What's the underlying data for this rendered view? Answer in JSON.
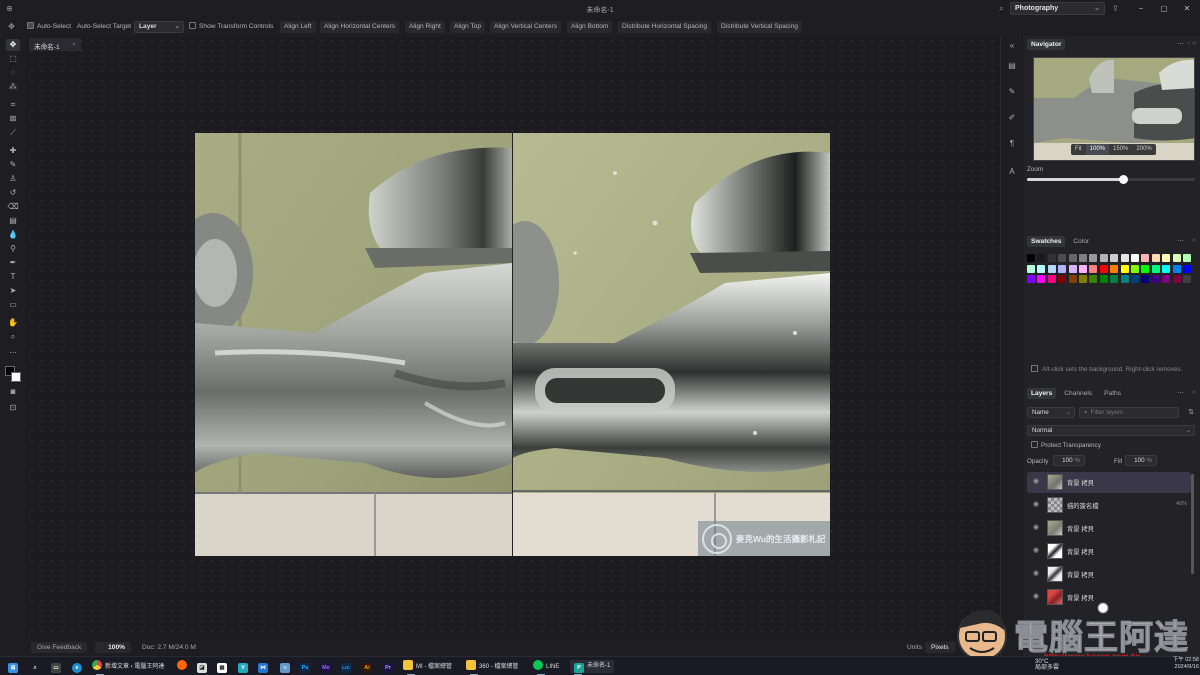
{
  "window": {
    "title": "未命名-1",
    "workspace": "Photography",
    "minimize": "−",
    "maximize": "▢",
    "close": "✕"
  },
  "options_bar": {
    "auto_select": "Auto-Select",
    "auto_select_target": "Auto-Select Target",
    "target_value": "Layer",
    "show_transform": "Show Transform Controls",
    "align_buttons": [
      "Align Left",
      "Align Horizontal Centers",
      "Align Right",
      "Align Top",
      "Align Vertical Centers",
      "Align Bottom",
      "Distribute Horizontal Spacing",
      "Distribute Vertical Spacing"
    ]
  },
  "document": {
    "tab_name": "未命名-1",
    "watermark_text": "麥克Wu的生活攝影札記"
  },
  "statusbar": {
    "feedback": "Give Feedback",
    "zoom": "100%",
    "doc_info": "Doc: 2.7 M/24.0 M",
    "units_label": "Units",
    "units_value": "Pixels"
  },
  "navigator": {
    "tab": "Navigator",
    "zoom_buttons": [
      "Fit",
      "100%",
      "150%",
      "200%"
    ],
    "active_zoom": "100%",
    "zoom_label": "Zoom",
    "zoom_level": 0.57
  },
  "swatches": {
    "tabs": [
      "Swatches",
      "Color"
    ],
    "hint": "Alt-click sets the background. Right-click removes.",
    "colors": [
      "#000000",
      "#1a1a1a",
      "#333333",
      "#4d4d4d",
      "#666666",
      "#808080",
      "#999999",
      "#b3b3b3",
      "#cccccc",
      "#e6e6e6",
      "#ffffff",
      "#ffb3b3",
      "#ffd9b3",
      "#ffffb3",
      "#d9ffb3",
      "#b3ffb3",
      "#b3ffd9",
      "#b3ffff",
      "#b3d9ff",
      "#b3b3ff",
      "#d9b3ff",
      "#ffb3ff",
      "#ff8080",
      "#ff0000",
      "#ff8000",
      "#ffff00",
      "#80ff00",
      "#00ff00",
      "#00ff80",
      "#00ffff",
      "#0080ff",
      "#0000ff",
      "#8000ff",
      "#ff00ff",
      "#ff0080",
      "#800000",
      "#804000",
      "#808000",
      "#408000",
      "#008000",
      "#008040",
      "#008080",
      "#004080",
      "#000080",
      "#400080",
      "#800080",
      "#800040",
      "#404040"
    ]
  },
  "layers": {
    "tabs": [
      "Layers",
      "Channels",
      "Paths"
    ],
    "filter_type": "Name",
    "filter_placeholder": "Filter layers",
    "blend_mode": "Normal",
    "protect": "Protect Transparency",
    "opacity_label": "Opacity",
    "opacity_value": "100",
    "fill_label": "Fill",
    "fill_value": "100",
    "percent": "%",
    "items": [
      {
        "name": "背景 拷貝",
        "opacity": ""
      },
      {
        "name": "描的簽名檔",
        "opacity": "40%"
      },
      {
        "name": "背景 拷貝",
        "opacity": ""
      },
      {
        "name": "背景 拷貝",
        "opacity": ""
      },
      {
        "name": "背景 拷貝",
        "opacity": ""
      },
      {
        "name": "背景 拷貝",
        "opacity": ""
      }
    ]
  },
  "taskbar": {
    "chrome_label": "新增文章 ‹ 電腦王阿達",
    "explorer1": "MI - 檔案總管",
    "explorer2": "360 - 檔案總管",
    "line": "LINE",
    "photopea": "未命名-1",
    "ps": "Ps",
    "me": "Me",
    "lrc": "LrC",
    "ai": "Ai",
    "pr": "Pr",
    "time": "下午 02:58",
    "date": "2024/9/16",
    "weather_temp": "30°C",
    "weather_text": "局部多雲"
  },
  "logo_text": "電腦王阿達",
  "logo_url": "http://www.kocpc.com.tw"
}
